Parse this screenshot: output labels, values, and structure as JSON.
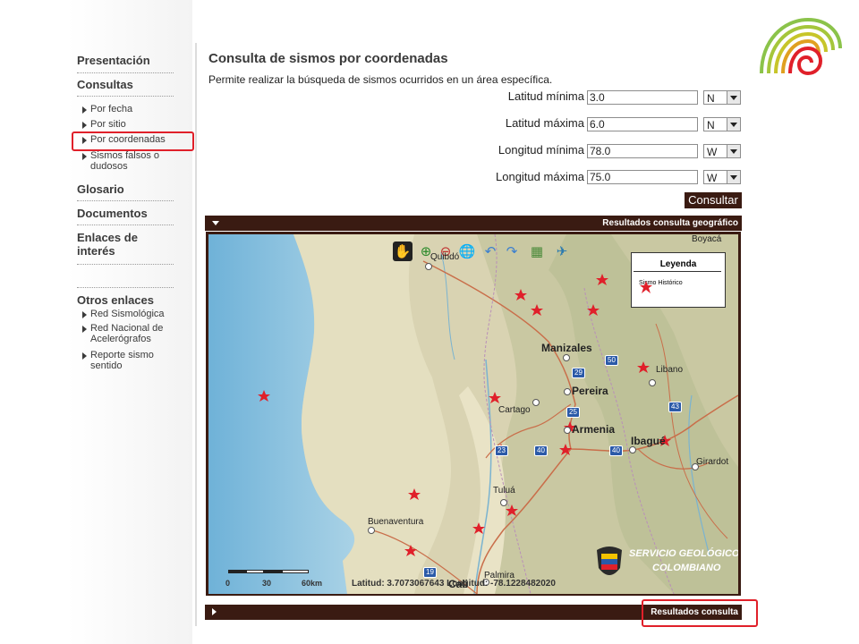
{
  "sidebar": {
    "presentacion": "Presentación",
    "consultas": "Consultas",
    "consultas_items": [
      "Por fecha",
      "Por sitio",
      "Por coordenadas",
      "Sismos falsos o dudosos"
    ],
    "glosario": "Glosario",
    "documentos": "Documentos",
    "enlaces": "Enlaces de interés",
    "otros": "Otros enlaces",
    "otros_items": [
      "Red Sismológica",
      "Red Nacional de Acelerógrafos",
      "Reporte sismo sentido"
    ]
  },
  "main": {
    "title": "Consulta de sismos por coordenadas",
    "description": "Permite realizar la búsqueda de sismos ocurridos en un área específica."
  },
  "form": {
    "fields": [
      {
        "label": "Latitud mínima",
        "value": "3.0",
        "dir": "N"
      },
      {
        "label": "Latitud máxima",
        "value": "6.0",
        "dir": "N"
      },
      {
        "label": "Longitud mínima",
        "value": "78.0",
        "dir": "W"
      },
      {
        "label": "Longitud máxima",
        "value": "75.0",
        "dir": "W"
      }
    ],
    "submit": "Consultar"
  },
  "results": {
    "geo_label": "Resultados consulta geográfico",
    "list_label": "Resultados consulta"
  },
  "map": {
    "legend_title": "Leyenda",
    "legend_item": "Sismo Histórico",
    "scale_labels": [
      "0",
      "30",
      "60km"
    ],
    "coords": "Latitud: 3.7073067643 Longitud: -78.1228482020",
    "cities": [
      "Quibdó",
      "Manizales",
      "Pereira",
      "Armenia",
      "Ibagué",
      "Cartago",
      "Tuluá",
      "Buenaventura",
      "Cali",
      "Palmira",
      "Libano",
      "Girardot",
      "Boyacá"
    ],
    "roads": [
      "50",
      "29",
      "43",
      "25",
      "40",
      "23",
      "40",
      "19"
    ],
    "logo_text": [
      "SERVICIO GEOLÓGICO",
      "COLOMBIANO"
    ],
    "colors": {
      "marker": "#e0202a",
      "accent": "#3a1b12",
      "sea": "#8fc3df"
    }
  }
}
